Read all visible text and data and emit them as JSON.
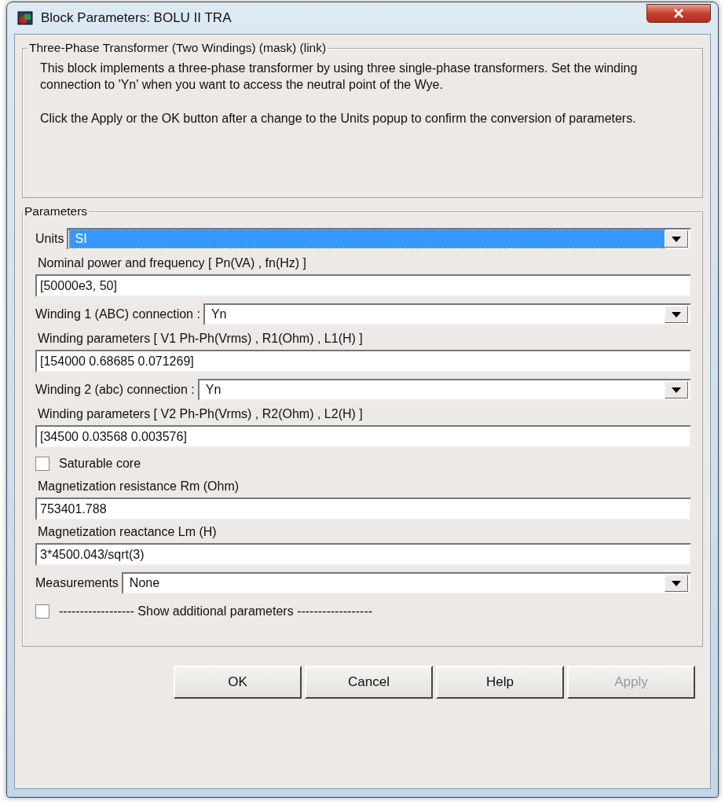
{
  "window": {
    "title": "Block Parameters: BOLU II TRA"
  },
  "description": {
    "title": "Three-Phase Transformer (Two Windings) (mask) (link)",
    "paragraphs": [
      "This block implements a three-phase transformer by using three single-phase transformers. Set the winding connection to 'Yn'  when you want to access the neutral point of the Wye.",
      "Click the Apply or the OK button after a change to the Units popup to confirm the conversion of parameters."
    ]
  },
  "parameters": {
    "title": "Parameters",
    "fields": [
      {
        "kind": "select",
        "label": "Units",
        "value": "SI",
        "focused": true
      },
      {
        "kind": "text",
        "label": "Nominal power and frequency  [ Pn(VA) , fn(Hz) ]",
        "value": "[50000e3, 50]"
      },
      {
        "kind": "select",
        "label": "Winding 1 (ABC) connection :",
        "value": "Yn",
        "focused": false
      },
      {
        "kind": "text",
        "label": "Winding parameters [ V1 Ph-Ph(Vrms) , R1(Ohm) , L1(H) ]",
        "value": "[154000 0.68685 0.071269]"
      },
      {
        "kind": "select",
        "label": "Winding 2 (abc) connection :",
        "value": "Yn",
        "focused": false
      },
      {
        "kind": "text",
        "label": "Winding parameters [ V2 Ph-Ph(Vrms) , R2(Ohm) , L2(H) ]",
        "value": "[34500 0.03568 0.003576]"
      },
      {
        "kind": "checkbox",
        "label": "Saturable core",
        "checked": false
      },
      {
        "kind": "text",
        "label": "Magnetization resistance  Rm (Ohm)",
        "value": "753401.788"
      },
      {
        "kind": "text",
        "label": "Magnetization reactance Lm (H)",
        "value": "3*4500.043/sqrt(3)"
      },
      {
        "kind": "select",
        "label": "Measurements",
        "value": "None",
        "focused": false
      },
      {
        "kind": "checkbox",
        "label": "------------------ Show additional parameters ------------------",
        "checked": false
      }
    ]
  },
  "buttons": [
    {
      "label": "OK",
      "disabled": false
    },
    {
      "label": "Cancel",
      "disabled": false
    },
    {
      "label": "Help",
      "disabled": false
    },
    {
      "label": "Apply",
      "disabled": true
    }
  ]
}
